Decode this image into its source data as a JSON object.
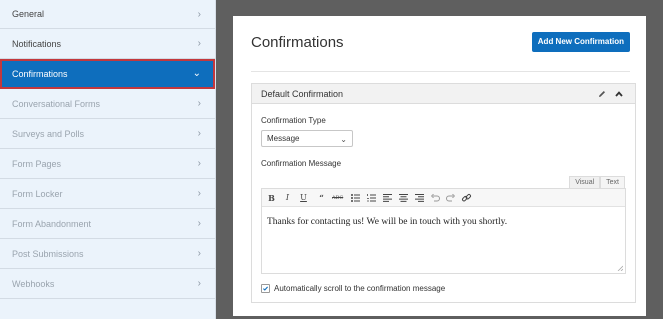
{
  "sidebar": {
    "items": [
      {
        "label": "General",
        "state": "normal"
      },
      {
        "label": "Notifications",
        "state": "normal"
      },
      {
        "label": "Confirmations",
        "state": "active"
      },
      {
        "label": "Conversational Forms",
        "state": "disabled"
      },
      {
        "label": "Surveys and Polls",
        "state": "disabled"
      },
      {
        "label": "Form Pages",
        "state": "disabled"
      },
      {
        "label": "Form Locker",
        "state": "disabled"
      },
      {
        "label": "Form Abandonment",
        "state": "disabled"
      },
      {
        "label": "Post Submissions",
        "state": "disabled"
      },
      {
        "label": "Webhooks",
        "state": "disabled"
      }
    ]
  },
  "panel": {
    "title": "Confirmations",
    "add_button": "Add New Confirmation"
  },
  "confirmation": {
    "title": "Default Confirmation",
    "type_label": "Confirmation Type",
    "type_value": "Message",
    "message_label": "Confirmation Message",
    "tabs": [
      "Visual",
      "Text"
    ],
    "message": "Thanks for contacting us! We will be in touch with you shortly.",
    "scroll_label": "Automatically scroll to the confirmation message",
    "scroll_checked": true
  },
  "icons": {
    "chevron": "chevron-right-icon",
    "edit": "pencil-icon",
    "collapse": "chevron-up-icon"
  },
  "colors": {
    "accent": "#0e6ebd",
    "active_border": "#c3383d",
    "sidebar_bg": "#ebf3fb",
    "frame_bg": "#5f5f5f"
  }
}
